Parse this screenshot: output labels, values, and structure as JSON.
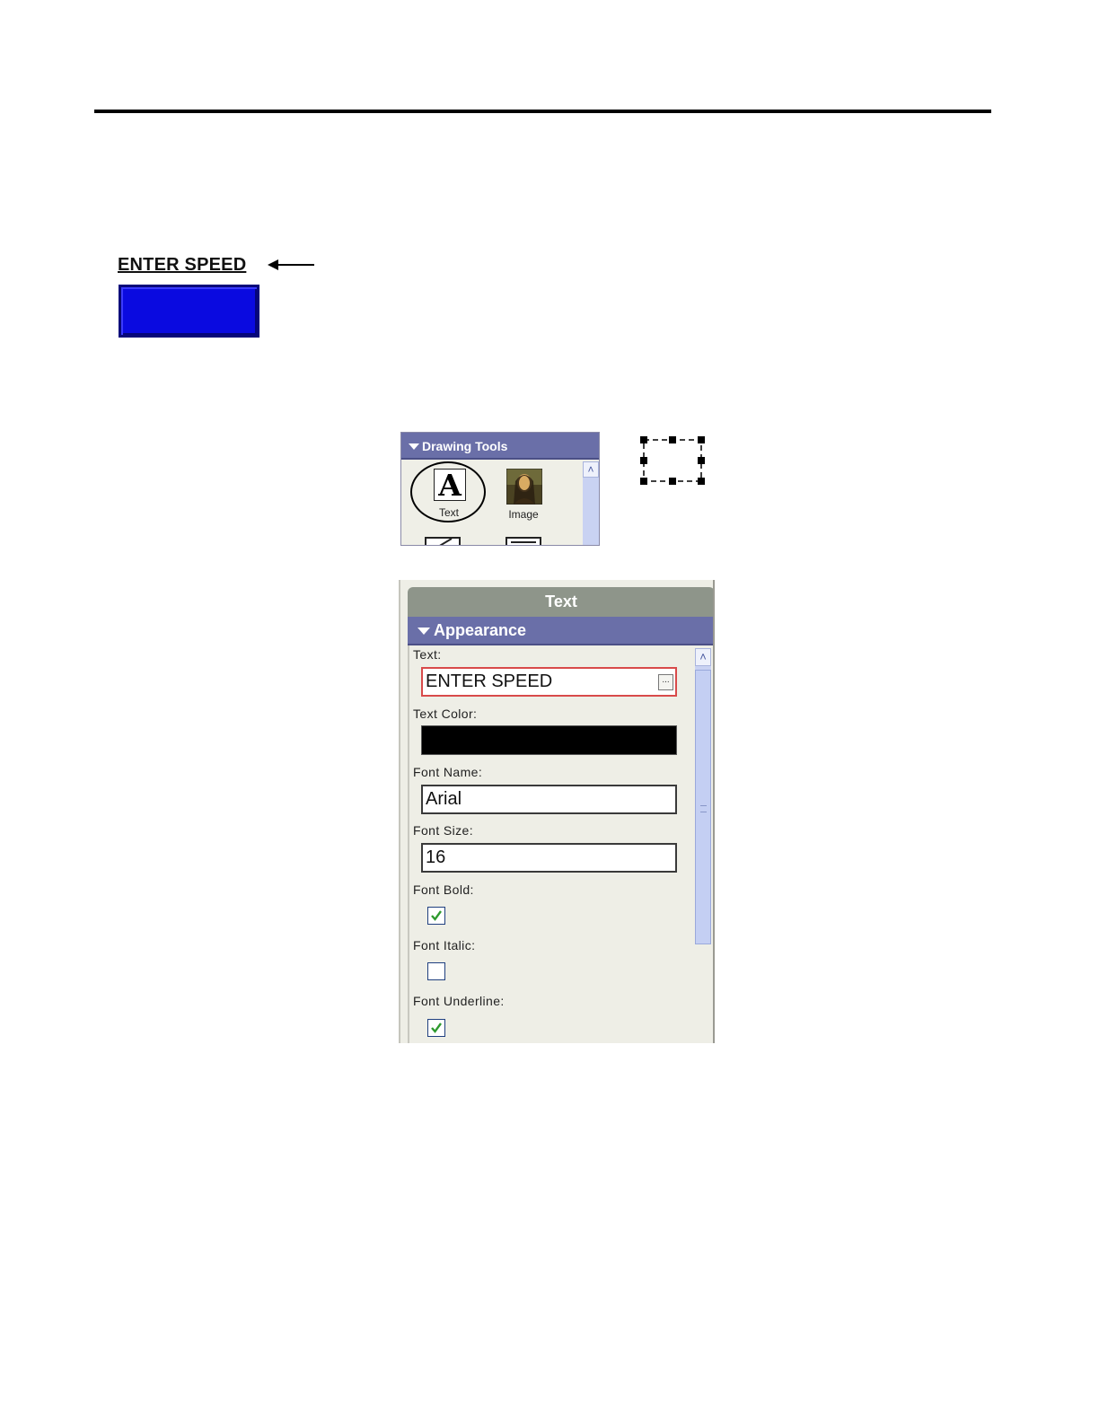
{
  "sample": {
    "label": "ENTER SPEED",
    "box_color": "#0a0ae0"
  },
  "drawing_tools": {
    "title": "Drawing Tools",
    "tools": [
      {
        "name": "Text",
        "icon": "letter-a-icon"
      },
      {
        "name": "Image",
        "icon": "mona-lisa-image-icon"
      }
    ]
  },
  "properties": {
    "title": "Text",
    "section": "Appearance",
    "text_label": "Text:",
    "text_value": "ENTER SPEED",
    "ellipsis": "...",
    "text_color_label": "Text Color:",
    "text_color_value": "#000000",
    "font_name_label": "Font Name:",
    "font_name_value": "Arial",
    "font_size_label": "Font Size:",
    "font_size_value": "16",
    "font_bold_label": "Font Bold:",
    "font_bold_checked": true,
    "font_italic_label": "Font Italic:",
    "font_italic_checked": false,
    "font_underline_label": "Font Underline:",
    "font_underline_checked": true
  },
  "colors": {
    "header_blue": "#6a6fa8",
    "title_gray": "#8e958a",
    "check_green": "#2e9a2e"
  }
}
